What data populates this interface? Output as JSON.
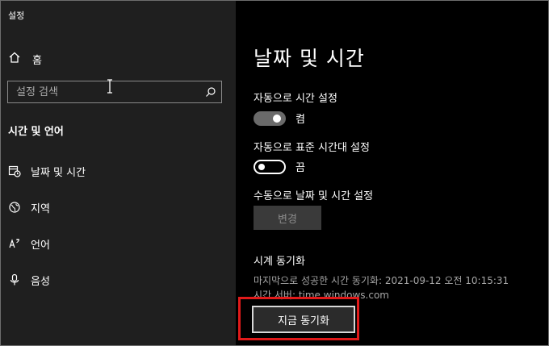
{
  "app": {
    "title": "설정"
  },
  "sidebar": {
    "home_label": "홈",
    "search": {
      "placeholder": "설정 검색"
    },
    "section_title": "시간 및 언어",
    "items": [
      {
        "label": "날짜 및 시간",
        "icon": "calendar-clock-icon"
      },
      {
        "label": "지역",
        "icon": "globe-icon"
      },
      {
        "label": "언어",
        "icon": "language-icon"
      },
      {
        "label": "음성",
        "icon": "microphone-icon"
      }
    ]
  },
  "main": {
    "title": "날짜 및 시간",
    "auto_time": {
      "label": "자동으로 시간 설정",
      "state": "켬",
      "on": true
    },
    "auto_timezone": {
      "label": "자동으로 표준 시간대 설정",
      "state": "끔",
      "on": false
    },
    "manual": {
      "label": "수동으로 날짜 및 시간 설정",
      "button": "변경"
    },
    "sync": {
      "title": "시계 동기화",
      "last_sync": "마지막으로 성공한 시간 동기화: 2021-09-12 오전 10:15:31",
      "server": "시간 서버: time.windows.com",
      "button": "지금 동기화"
    }
  },
  "colors": {
    "highlight": "#e01a1a",
    "sidebar_bg": "#1f1f1f",
    "main_bg": "#000000"
  }
}
